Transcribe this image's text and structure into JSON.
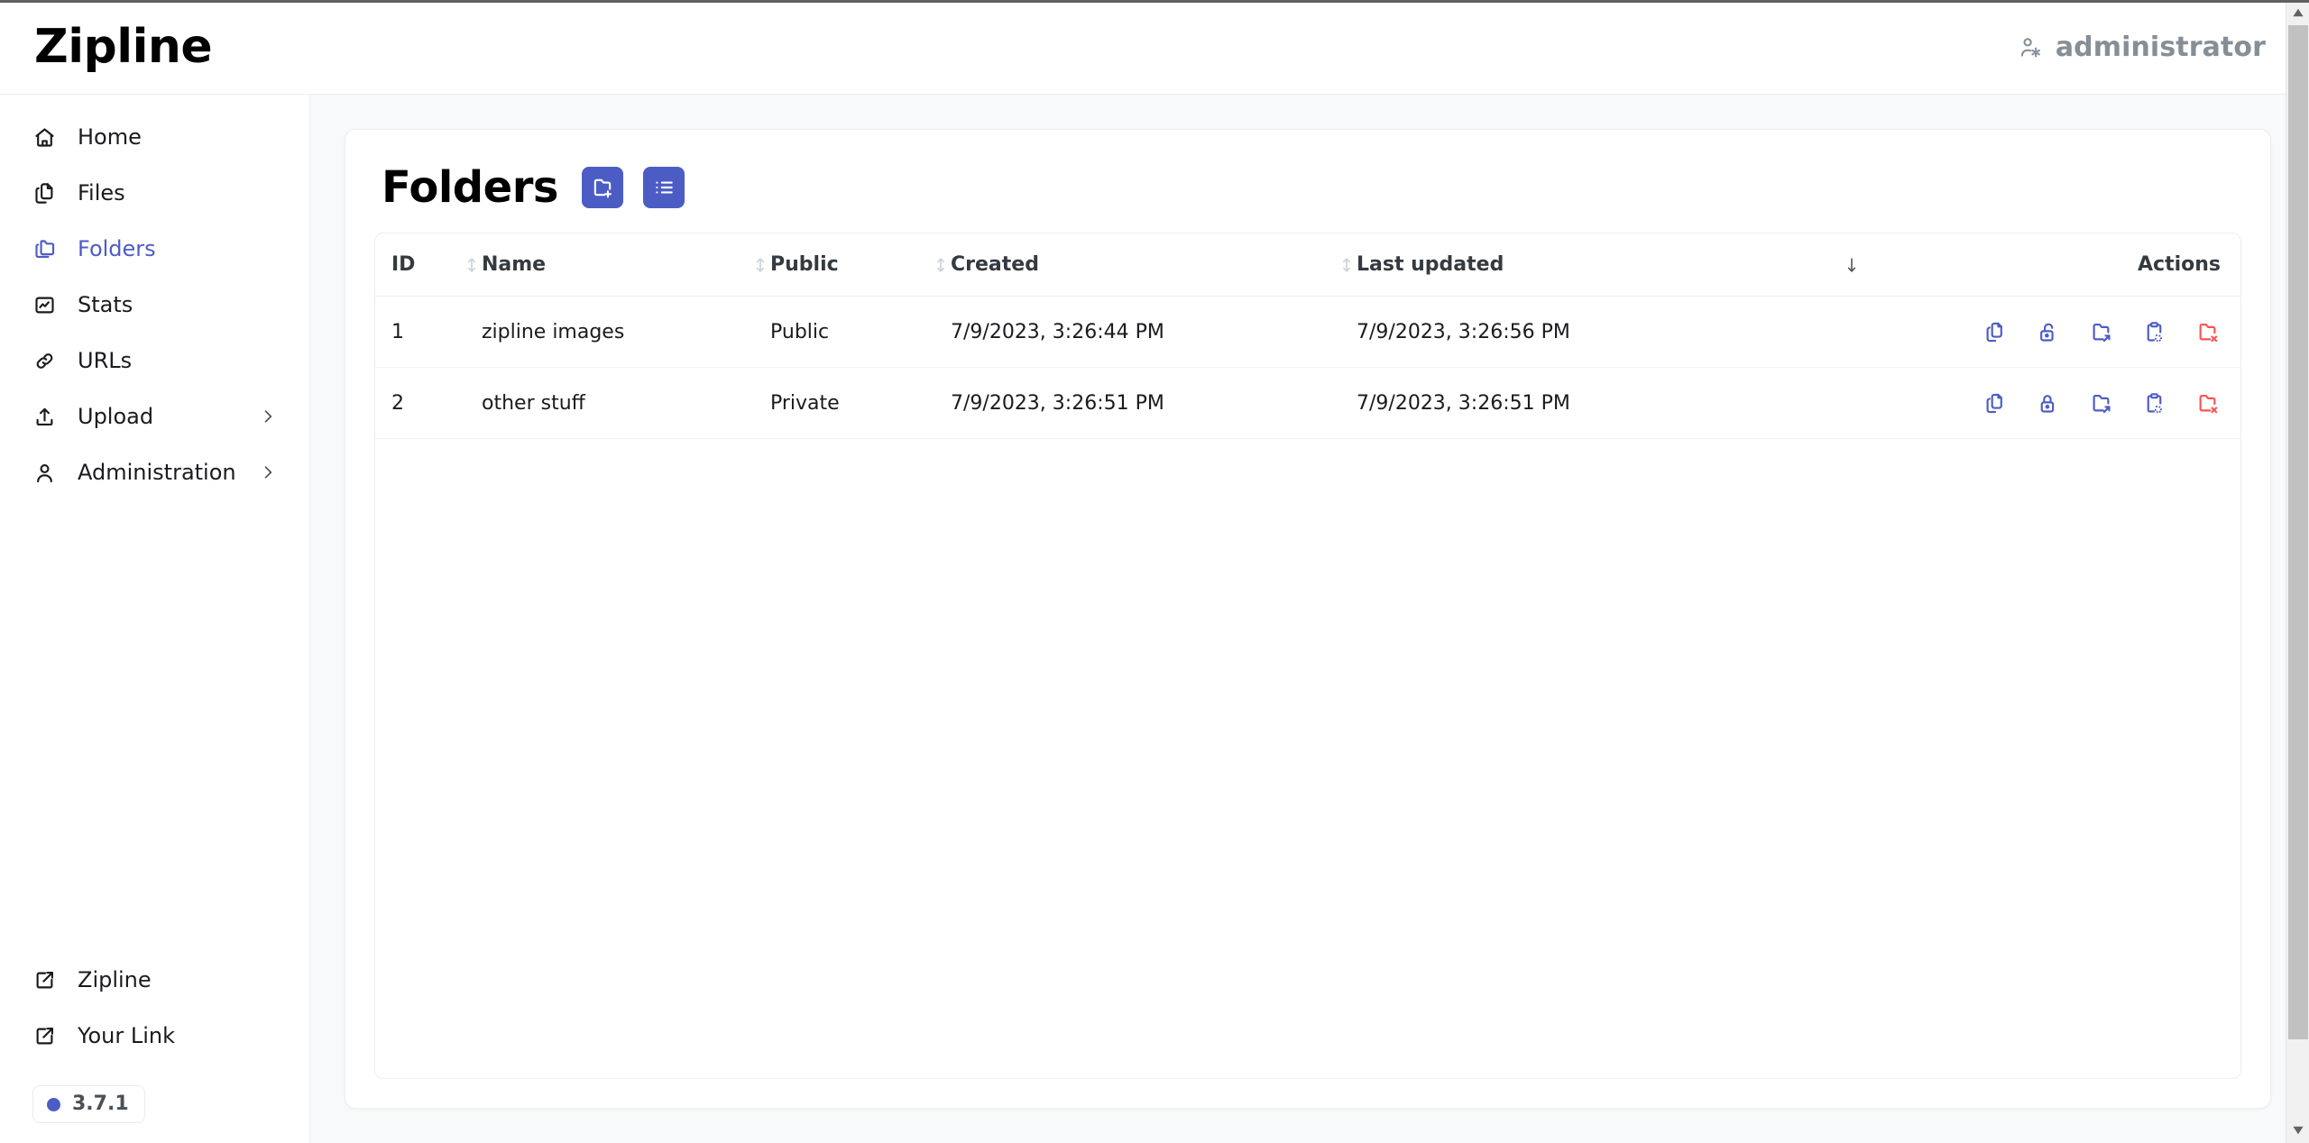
{
  "header": {
    "brand": "Zipline",
    "user_name": "administrator",
    "user_icon": "user-cog-icon"
  },
  "sidebar": {
    "items": [
      {
        "label": "Home",
        "icon": "home-icon",
        "active": false,
        "expandable": false
      },
      {
        "label": "Files",
        "icon": "files-icon",
        "active": false,
        "expandable": false
      },
      {
        "label": "Folders",
        "icon": "folders-icon",
        "active": true,
        "expandable": false
      },
      {
        "label": "Stats",
        "icon": "chart-icon",
        "active": false,
        "expandable": false
      },
      {
        "label": "URLs",
        "icon": "link-icon",
        "active": false,
        "expandable": false
      },
      {
        "label": "Upload",
        "icon": "upload-icon",
        "active": false,
        "expandable": true
      },
      {
        "label": "Administration",
        "icon": "user-icon",
        "active": false,
        "expandable": true
      }
    ],
    "footer_links": [
      {
        "label": "Zipline",
        "icon": "external-link-icon"
      },
      {
        "label": "Your Link",
        "icon": "external-link-icon"
      }
    ],
    "version": "3.7.1"
  },
  "page": {
    "title": "Folders",
    "actions": [
      {
        "name": "create-folder-button",
        "icon": "folder-plus-icon"
      },
      {
        "name": "toggle-view-button",
        "icon": "list-icon"
      }
    ]
  },
  "table": {
    "columns": [
      {
        "label": "ID",
        "sortable": true,
        "sort": "none"
      },
      {
        "label": "Name",
        "sortable": true,
        "sort": "none"
      },
      {
        "label": "Public",
        "sortable": true,
        "sort": "none"
      },
      {
        "label": "Created",
        "sortable": true,
        "sort": "none"
      },
      {
        "label": "Last updated",
        "sortable": true,
        "sort": "desc"
      },
      {
        "label": "Actions",
        "sortable": false,
        "sort": "none"
      }
    ],
    "rows": [
      {
        "id": "1",
        "name": "zipline images",
        "public": "Public",
        "created": "7/9/2023, 3:26:44 PM",
        "updated": "7/9/2023, 3:26:56 PM",
        "lock_state": "unlocked",
        "actions": [
          {
            "name": "copy-files-button",
            "icon": "copy-files-icon"
          },
          {
            "name": "visibility-button",
            "icon": "lock-open-icon"
          },
          {
            "name": "open-folder-button",
            "icon": "folder-share-icon"
          },
          {
            "name": "copy-link-button",
            "icon": "clipboard-copy-icon"
          },
          {
            "name": "delete-folder-button",
            "icon": "folder-x-icon"
          }
        ]
      },
      {
        "id": "2",
        "name": "other stuff",
        "public": "Private",
        "created": "7/9/2023, 3:26:51 PM",
        "updated": "7/9/2023, 3:26:51 PM",
        "lock_state": "locked",
        "actions": [
          {
            "name": "copy-files-button",
            "icon": "copy-files-icon"
          },
          {
            "name": "visibility-button",
            "icon": "lock-closed-icon"
          },
          {
            "name": "open-folder-button",
            "icon": "folder-share-icon"
          },
          {
            "name": "copy-link-button",
            "icon": "clipboard-copy-icon"
          },
          {
            "name": "delete-folder-button",
            "icon": "folder-x-icon"
          }
        ]
      }
    ]
  },
  "colors": {
    "accent": "#4c5cc5",
    "danger": "#fa5252",
    "muted": "#868e96",
    "page_bg": "#f8f9fa",
    "surface": "#ffffff",
    "border": "#eceef0"
  }
}
